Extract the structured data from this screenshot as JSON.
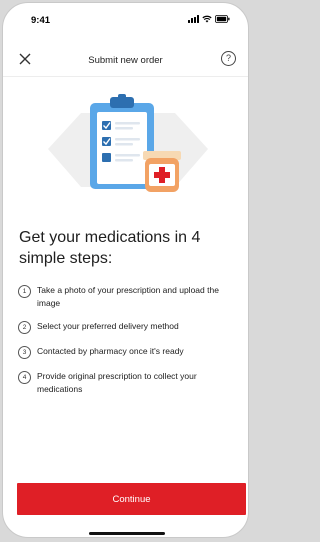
{
  "status_bar": {
    "time": "9:41"
  },
  "nav": {
    "title": "Submit new order",
    "help_glyph": "?",
    "close_icon": "close-icon",
    "help_icon": "help-icon"
  },
  "main": {
    "headline": "Get your medications in 4 simple steps:",
    "steps": [
      {
        "num": "1",
        "text": "Take a photo of your prescription and upload the image"
      },
      {
        "num": "2",
        "text": "Select your preferred delivery method"
      },
      {
        "num": "3",
        "text": "Contacted by pharmacy once it's ready"
      },
      {
        "num": "4",
        "text": "Provide original prescription to collect your medications"
      }
    ]
  },
  "footer": {
    "continue_label": "Continue"
  },
  "colors": {
    "accent": "#df1f26",
    "clipboard_blue": "#5aa7e8",
    "clipboard_dark": "#2d6fb0",
    "jar_orange": "#f2a264",
    "jar_cap": "#f7d9b3"
  }
}
